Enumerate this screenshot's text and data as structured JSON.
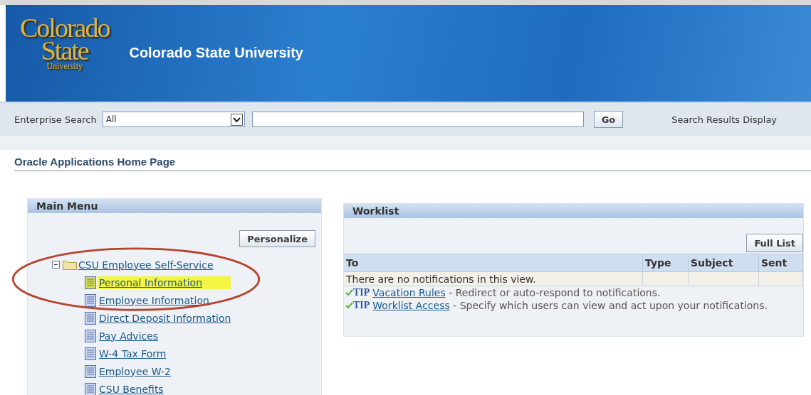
{
  "header": {
    "logo": {
      "line_1": "Colorado",
      "line_2": "State",
      "line_3": "University"
    },
    "title": "Colorado State University"
  },
  "search_bar": {
    "label": "Enterprise Search",
    "scope": "All",
    "button": "Go",
    "trailing_text": "Search Results Display"
  },
  "page_title": "Oracle Applications Home Page",
  "main_menu": {
    "title": "Main Menu",
    "button": "Personalize",
    "tree": [
      {
        "label": "CSU Employee Self-Service",
        "expanded": true,
        "children": [
          {
            "label": "Personal Information",
            "highlighted": true
          },
          {
            "label": "Employee Information",
            "highlighted": false
          },
          {
            "label": "Direct Deposit Information",
            "highlighted": false
          },
          {
            "label": "Pay Advices",
            "highlighted": false
          },
          {
            "label": "W-4 Tax Form",
            "highlighted": false
          },
          {
            "label": "Employee W-2",
            "highlighted": false
          },
          {
            "label": "CSU Benefits",
            "highlighted": false
          }
        ]
      }
    ]
  },
  "callout": {
    "kind": "ellipse"
  },
  "worklist": {
    "title": "Worklist",
    "button": "Full List",
    "columns": [
      "To",
      "Type",
      "Subject",
      "Sent"
    ],
    "rows": [
      [
        "There are no notifications in this view.",
        "",
        "",
        ""
      ]
    ],
    "tips": [
      {
        "badge": "TIP",
        "link": "Vacation Rules",
        "text": " - Redirect or auto-respond to notifications."
      },
      {
        "badge": "TIP",
        "link": "Worklist Access",
        "text": " - Specify which users can view and act upon your notifications."
      }
    ]
  }
}
